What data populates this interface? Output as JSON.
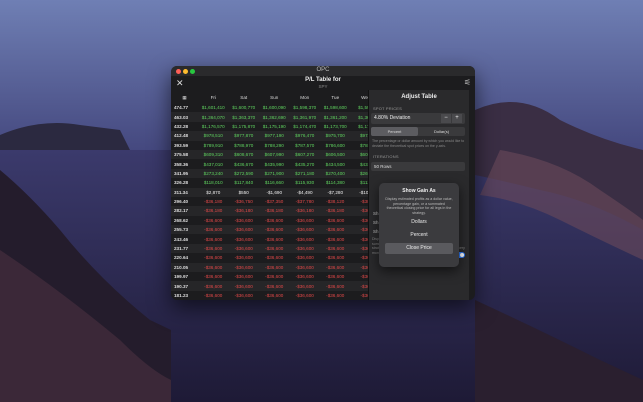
{
  "window": {
    "title": "OPC"
  },
  "header": {
    "title": "P/L Table for",
    "subtitle": "SPY"
  },
  "table": {
    "columns": [
      "Fri",
      "Sat",
      "Sun",
      "Mon",
      "Tue",
      "Wed"
    ],
    "rows": [
      {
        "price": "474.77",
        "cells": [
          "$1,601,410",
          "$1,600,770",
          "$1,600,090",
          "$1,598,370",
          "$1,598,600",
          "$1,597,"
        ],
        "tone": "g"
      },
      {
        "price": "463.03",
        "cells": [
          "$1,364,070",
          "$1,363,370",
          "$1,362,690",
          "$1,361,970",
          "$1,361,200",
          "$1,360,"
        ],
        "tone": "g"
      },
      {
        "price": "432.28",
        "cells": [
          "$1,176,570",
          "$1,175,870",
          "$1,175,190",
          "$1,174,470",
          "$1,173,700",
          "$1,172,"
        ],
        "tone": "g"
      },
      {
        "price": "412.48",
        "cells": [
          "$978,510",
          "$977,870",
          "$977,190",
          "$976,470",
          "$975,700",
          "$974,"
        ],
        "tone": "g"
      },
      {
        "price": "393.59",
        "cells": [
          "$789,910",
          "$788,970",
          "$788,290",
          "$787,570",
          "$786,600",
          "$785,"
        ],
        "tone": "g"
      },
      {
        "price": "375.58",
        "cells": [
          "$609,310",
          "$608,670",
          "$607,990",
          "$607,270",
          "$606,500",
          "$605,"
        ],
        "tone": "g"
      },
      {
        "price": "358.36",
        "cells": [
          "$437,010",
          "$436,670",
          "$435,990",
          "$435,270",
          "$434,500",
          "$433,"
        ],
        "tone": "g"
      },
      {
        "price": "341.95",
        "cells": [
          "$273,240",
          "$272,590",
          "$271,900",
          "$271,180",
          "$270,400",
          "$269,"
        ],
        "tone": "g"
      },
      {
        "price": "326.28",
        "cells": [
          "$118,010",
          "$117,840",
          "$116,660",
          "$115,930",
          "$114,380",
          "$113,"
        ],
        "tone": "g"
      },
      {
        "price": "311.34",
        "cells": [
          "$2,870",
          "$550",
          "-$1,690",
          "-$4,490",
          "-$7,280",
          "-$10,3"
        ],
        "tone": "w"
      },
      {
        "price": "296.40",
        "cells": [
          "-$36,180",
          "-$36,750",
          "-$37,350",
          "-$37,780",
          "-$38,120",
          "-$38,"
        ],
        "tone": "r"
      },
      {
        "price": "282.17",
        "cells": [
          "-$36,180",
          "-$36,180",
          "-$36,180",
          "-$36,180",
          "-$36,180",
          "-$36,"
        ],
        "tone": "r"
      },
      {
        "price": "268.62",
        "cells": [
          "-$36,600",
          "-$36,600",
          "-$36,600",
          "-$36,600",
          "-$36,600",
          "-$36,"
        ],
        "tone": "r"
      },
      {
        "price": "255.73",
        "cells": [
          "-$36,600",
          "-$36,600",
          "-$36,600",
          "-$36,600",
          "-$36,600",
          "-$36,"
        ],
        "tone": "r"
      },
      {
        "price": "243.46",
        "cells": [
          "-$36,600",
          "-$36,600",
          "-$36,600",
          "-$36,600",
          "-$36,600",
          "-$36,"
        ],
        "tone": "r"
      },
      {
        "price": "231.77",
        "cells": [
          "-$36,600",
          "-$36,600",
          "-$36,600",
          "-$36,600",
          "-$36,600",
          "-$36,"
        ],
        "tone": "r"
      },
      {
        "price": "220.64",
        "cells": [
          "-$36,600",
          "-$36,600",
          "-$36,600",
          "-$36,600",
          "-$36,600",
          "-$36,"
        ],
        "tone": "r"
      },
      {
        "price": "210.05",
        "cells": [
          "-$36,600",
          "-$36,600",
          "-$36,600",
          "-$36,600",
          "-$36,600",
          "-$36,"
        ],
        "tone": "r"
      },
      {
        "price": "199.97",
        "cells": [
          "-$36,600",
          "-$36,600",
          "-$36,600",
          "-$36,600",
          "-$36,600",
          "-$36,"
        ],
        "tone": "r"
      },
      {
        "price": "190.37",
        "cells": [
          "-$36,600",
          "-$36,600",
          "-$36,600",
          "-$36,600",
          "-$36,600",
          "-$36,"
        ],
        "tone": "r"
      },
      {
        "price": "181.23",
        "cells": [
          "-$36,600",
          "-$36,600",
          "-$36,600",
          "-$36,600",
          "-$36,600",
          "-$36,"
        ],
        "tone": "r"
      }
    ]
  },
  "panel": {
    "title": "Adjust Table",
    "spot_label": "SPOT PRICES",
    "deviation": "4.80% Deviation",
    "minus": "−",
    "plus": "+",
    "seg_percent": "Percent",
    "seg_dollars": "Dollar(s)",
    "help": "The percentage or dollar amount by which you would like to deviate the theoretical spot prices on the y-axis.",
    "iterations_label": "ITERATIONS",
    "iterations_value": "50 Rows",
    "show_label_1": "Sh",
    "show_label_2": "Sh",
    "show_label_3": "Sh",
    "footer": "Display gain as a dollar value, percentage gain, or a summated theoretical closing price for all legs in the strategy. Tap every day, weekly, monthly, or the first of every month."
  },
  "popup": {
    "title": "Show Gain As",
    "message": "Display estimated profits as a dollar value, percentage gain, or a summated theoretical closing price for all legs in the strategy.",
    "btn_dollars": "Dollars",
    "btn_percent": "Percent",
    "btn_close": "Close Price"
  },
  "colors": {
    "green": "#5fd35f",
    "red": "#e04848",
    "accent": "#2f7bf6"
  }
}
